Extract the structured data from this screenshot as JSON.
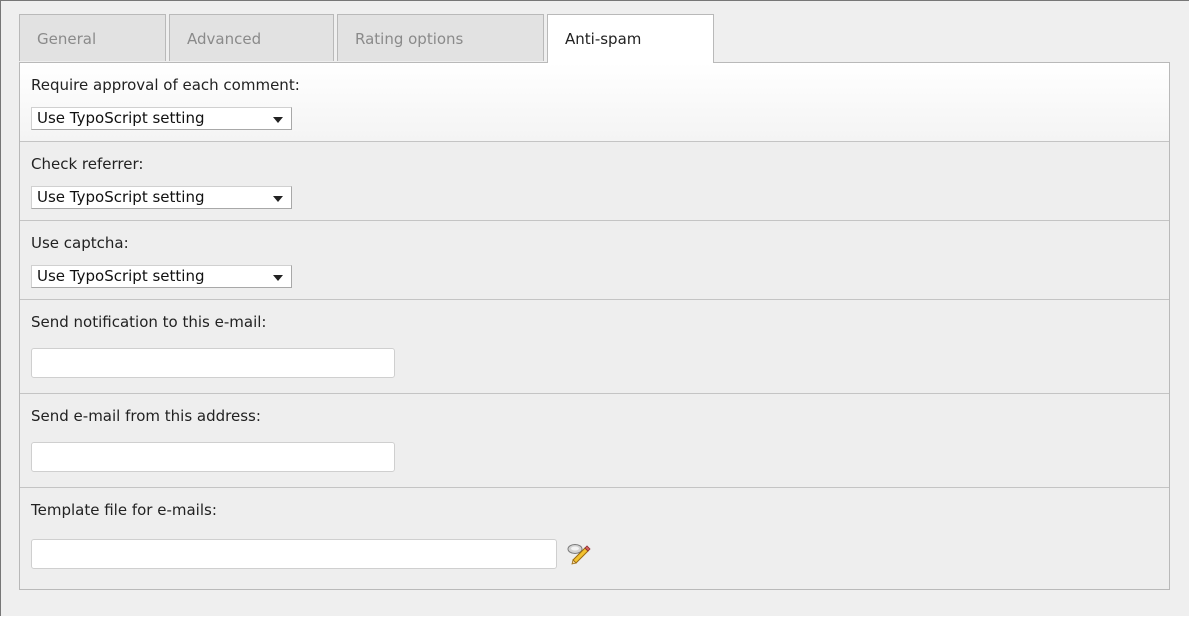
{
  "tabs": [
    {
      "label": "General",
      "active": false
    },
    {
      "label": "Advanced",
      "active": false
    },
    {
      "label": "Rating options",
      "active": false
    },
    {
      "label": "Anti-spam",
      "active": true
    }
  ],
  "fields": {
    "require_approval": {
      "label": "Require approval of each comment:",
      "value": "Use TypoScript setting"
    },
    "check_referrer": {
      "label": "Check referrer:",
      "value": "Use TypoScript setting"
    },
    "use_captcha": {
      "label": "Use captcha:",
      "value": "Use TypoScript setting"
    },
    "notification_email": {
      "label": "Send notification to this e-mail:",
      "value": ""
    },
    "from_email": {
      "label": "Send e-mail from this address:",
      "value": ""
    },
    "template_file": {
      "label": "Template file for e-mails:",
      "value": ""
    }
  },
  "icons": {
    "template_wizard": "wizard-pencil-icon"
  }
}
